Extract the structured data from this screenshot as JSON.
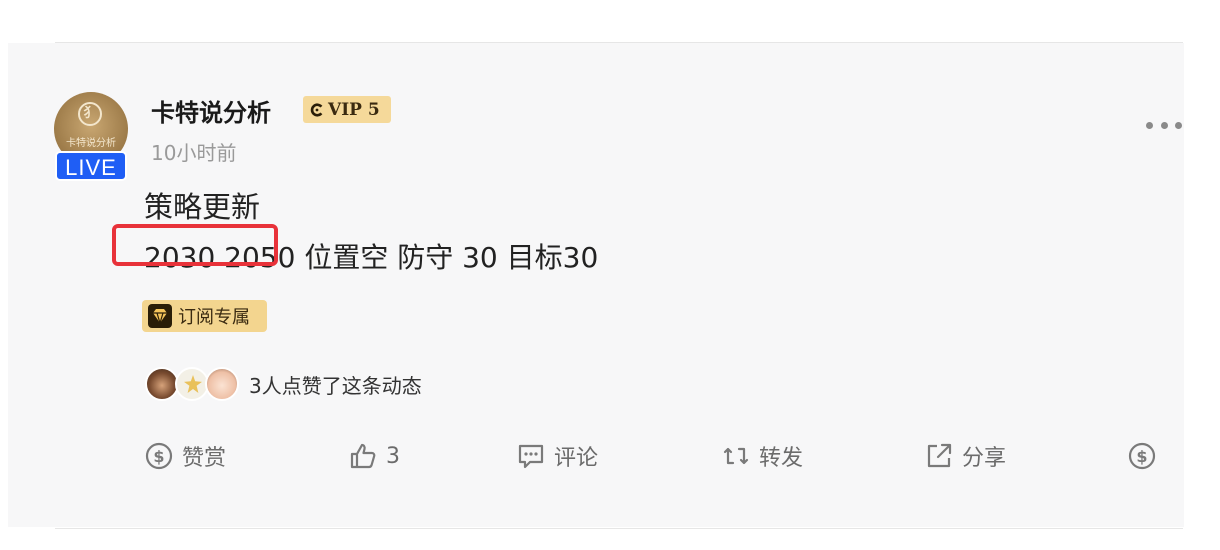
{
  "post": {
    "author": {
      "name": "卡特说分析",
      "avatar_logo_text": "卡特说分析",
      "avatar_logo_glyph": "犭",
      "live_label": "LIVE",
      "vip_label": "VIP 5"
    },
    "time": "10小时前",
    "title": "策略更新",
    "body": "2030  2050  位置空 防守 30  目标30",
    "badge": "订阅专属",
    "likes_text": "3人点赞了这条动态"
  },
  "actions": {
    "reward_label": "赞赏",
    "like_count": "3",
    "comment_label": "评论",
    "repost_label": "转发",
    "share_label": "分享"
  },
  "colors": {
    "live_badge": "#1f5ef5",
    "vip_badge": "#f5d99a",
    "subscribe_badge": "#f3d58f",
    "highlight_box": "#e8323a",
    "card_background": "#f7f7f8"
  },
  "icons": [
    "more-icon",
    "reward-icon",
    "like-icon",
    "comment-icon",
    "repost-icon",
    "share-icon",
    "tip-icon",
    "diamond-icon",
    "vip-icon"
  ]
}
